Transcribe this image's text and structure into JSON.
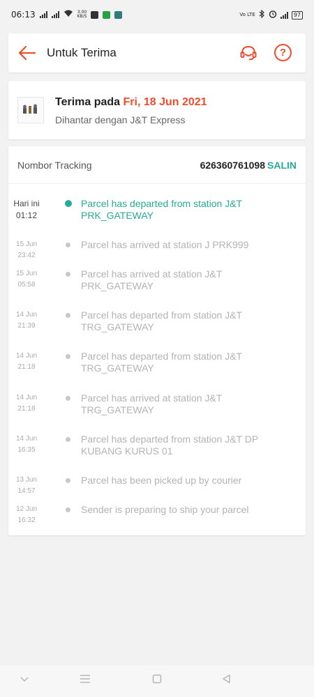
{
  "status_bar": {
    "time": "06:13",
    "speed_top": "3.00",
    "speed_bottom": "KB/S",
    "volte": "Vo LTE",
    "battery": "97"
  },
  "header": {
    "title": "Untuk Terima"
  },
  "delivery": {
    "received_prefix": "Terima pada ",
    "received_date": "Fri, 18 Jun 2021",
    "courier_text": "Dihantar dengan J&T Express"
  },
  "tracking": {
    "label": "Nombor Tracking",
    "number": "626360761098",
    "copy_label": "SALIN",
    "events": [
      {
        "date": "Hari ini",
        "time": "01:12",
        "text": "Parcel has departed from station J&T PRK_GATEWAY"
      },
      {
        "date": "15 Jun",
        "time": "23:42",
        "text": "Parcel has arrived at station J PRK999"
      },
      {
        "date": "15 Jun",
        "time": "05:58",
        "text": "Parcel has arrived at station J&T PRK_GATEWAY"
      },
      {
        "date": "14 Jun",
        "time": "21:39",
        "text": "Parcel has departed from station J&T TRG_GATEWAY"
      },
      {
        "date": "14 Jun",
        "time": "21:18",
        "text": "Parcel has departed from station J&T TRG_GATEWAY"
      },
      {
        "date": "14 Jun",
        "time": "21:18",
        "text": "Parcel has arrived at station J&T TRG_GATEWAY"
      },
      {
        "date": "14 Jun",
        "time": "16:35",
        "text": "Parcel has departed from station J&T DP KUBANG KURUS 01"
      },
      {
        "date": "13 Jun",
        "time": "14:57",
        "text": "Parcel has been picked up by courier"
      },
      {
        "date": "12 Jun",
        "time": "16:32",
        "text": "Sender is preparing to ship your parcel"
      }
    ]
  },
  "colors": {
    "accent": "#ee4d2d",
    "teal": "#26aa99"
  }
}
